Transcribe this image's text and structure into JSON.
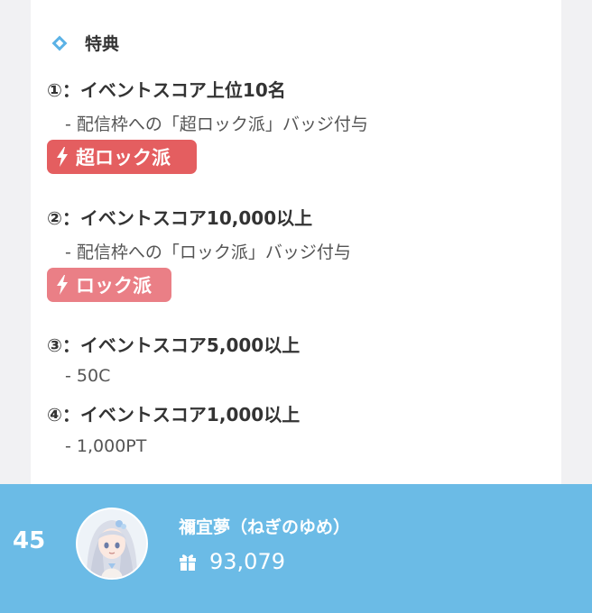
{
  "section": {
    "title": "特典",
    "icon": "diamond-icon"
  },
  "rewards": [
    {
      "title": "①：イベントスコア上位10名",
      "desc": "- 配信枠への「超ロック派」バッジ付与"
    },
    {
      "title": "②：イベントスコア10,000以上",
      "desc": "- 配信枠への「ロック派」バッジ付与"
    },
    {
      "title": "③：イベントスコア5,000以上",
      "desc": "- 50C"
    },
    {
      "title": "④：イベントスコア1,000以上",
      "desc": "- 1,000PT"
    }
  ],
  "badges": {
    "super": {
      "label": "超ロック派",
      "icon": "lightning-icon",
      "color": "#e45e60"
    },
    "rock": {
      "label": "ロック派",
      "icon": "lightning-icon",
      "color": "#ea7f86"
    }
  },
  "ranking": {
    "rank": "45",
    "name": "禰宜夢（ねぎのゆめ）",
    "score": "93,079",
    "score_icon": "gift-icon",
    "bar_color": "#6bbbe6"
  }
}
